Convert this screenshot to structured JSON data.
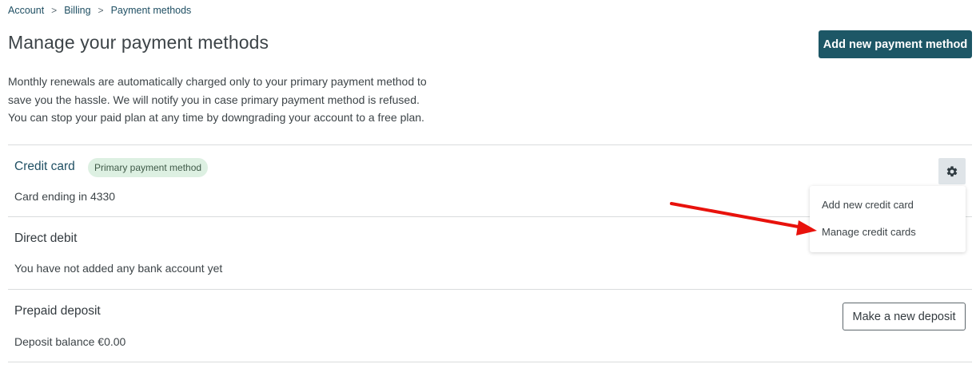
{
  "breadcrumb": {
    "items": [
      "Account",
      "Billing",
      "Payment methods"
    ],
    "separator": ">"
  },
  "page": {
    "title": "Manage your payment methods",
    "add_button_label": "Add new payment method",
    "intro": "Monthly renewals are automatically charged only to your primary payment method to save you the hassle. We will notify you in case primary payment method is refused. You can stop your paid plan at any time by downgrading your account to a free plan."
  },
  "credit_card": {
    "title": "Credit card",
    "badge": "Primary payment method",
    "subtitle": "Card ending in 4330",
    "settings_icon": "gear-icon"
  },
  "settings_menu": {
    "items": [
      "Add new credit card",
      "Manage credit cards"
    ]
  },
  "direct_debit": {
    "title": "Direct debit",
    "subtitle": "You have not added any bank account yet"
  },
  "prepaid_deposit": {
    "title": "Prepaid deposit",
    "subtitle": "Deposit balance €0.00",
    "button_label": "Make a new deposit"
  },
  "colors": {
    "primary": "#1d5766",
    "badge_bg": "#ddf0e2",
    "annotation_arrow": "#e8120c"
  }
}
